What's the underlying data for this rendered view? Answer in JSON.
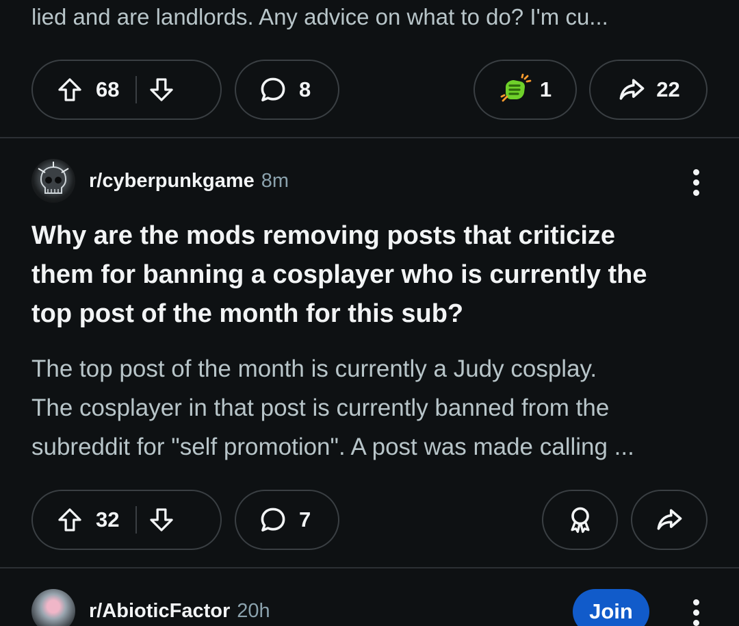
{
  "previous_post": {
    "snippet": "lied and are landlords. Any advice on what to do? I'm cu...",
    "votes": "68",
    "comments": "8",
    "awards": "1",
    "shares": "22"
  },
  "post": {
    "subreddit": "r/cyberpunkgame",
    "time": "8m",
    "title": "Why are the mods removing posts that criticize them for banning a cosplayer who is currently the top post of the month for this sub?",
    "title_lines": [
      "Why are the mods removing posts that criticize",
      "them for banning a cosplayer who is currently the",
      "top post of the month for this sub?"
    ],
    "body_lines": [
      "The top post of the month is currently a Judy cosplay.",
      "The cosplayer in that post is currently banned from the",
      "subreddit for \"self promotion\". A post was made calling ..."
    ],
    "votes": "32",
    "comments": "7"
  },
  "next_post": {
    "subreddit": "r/AbioticFactor",
    "time": "20h",
    "join_label": "Join"
  },
  "icons": {
    "upvote": "arrow-up-icon",
    "downvote": "arrow-down-icon",
    "comment": "speech-bubble-icon",
    "award": "award-ribbon-icon",
    "share": "share-arrow-icon",
    "more": "kebab-menu-icon"
  },
  "colors": {
    "background": "#0e1113",
    "join_button": "#115bca",
    "award_green": "#6fd12a"
  }
}
